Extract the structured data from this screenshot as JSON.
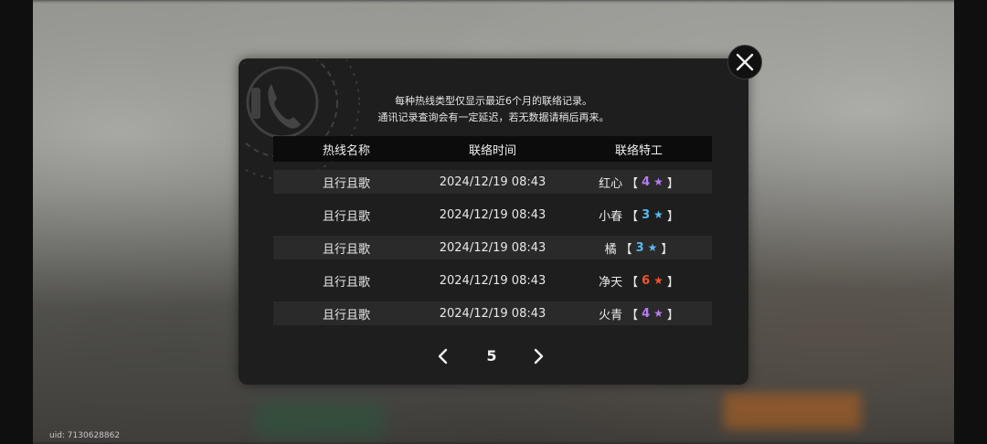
{
  "uid_text": "uid: 7130628862",
  "notice": {
    "line1": "每种热线类型仅显示最近6个月的联络记录。",
    "line2": "通讯记录查询会有一定延迟，若无数据请稍后再来。"
  },
  "table": {
    "headers": [
      "热线名称",
      "联络时间",
      "联络特工"
    ],
    "rows": [
      {
        "hotline": "且行且歌",
        "time": "2024/12/19 08:43",
        "agent": "红心",
        "rank": "4",
        "star": "★",
        "color": "#b57cf2"
      },
      {
        "hotline": "且行且歌",
        "time": "2024/12/19 08:43",
        "agent": "小春",
        "rank": "3",
        "star": "★",
        "color": "#5ab8f0"
      },
      {
        "hotline": "且行且歌",
        "time": "2024/12/19 08:43",
        "agent": "橘",
        "rank": "3",
        "star": "★",
        "color": "#5ab8f0"
      },
      {
        "hotline": "且行且歌",
        "time": "2024/12/19 08:43",
        "agent": "净天",
        "rank": "6",
        "star": "★",
        "color": "#f0552e"
      },
      {
        "hotline": "且行且歌",
        "time": "2024/12/19 08:43",
        "agent": "火青",
        "rank": "4",
        "star": "★",
        "color": "#b57cf2"
      }
    ]
  },
  "pager": {
    "current_page": "5",
    "prev_icon": "chevron-left-icon",
    "next_icon": "chevron-right-icon"
  },
  "close_icon": "close-icon"
}
